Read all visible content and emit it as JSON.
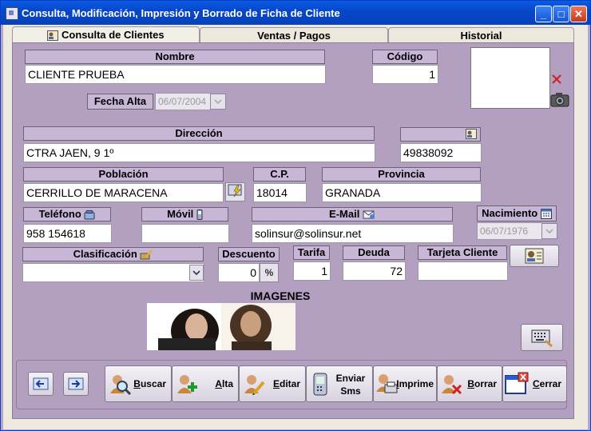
{
  "window": {
    "title": "Consulta, Modificación, Impresión y Borrado de Ficha de Cliente",
    "min_label": "_",
    "max_label": "□",
    "close_label": "✕"
  },
  "tabs": [
    {
      "label": "Consulta de Clientes",
      "active": true
    },
    {
      "label": "Ventas / Pagos",
      "active": false
    },
    {
      "label": "Historial",
      "active": false
    }
  ],
  "form": {
    "nombre": {
      "label": "Nombre",
      "value": "CLIENTE PRUEBA"
    },
    "codigo": {
      "label": "Código",
      "value": "1"
    },
    "fecha_alta": {
      "label": "Fecha Alta",
      "value": "06/07/2004"
    },
    "direccion": {
      "label": "Dirección",
      "value": "CTRA JAEN, 9 1º"
    },
    "dni": {
      "label": "",
      "value": "49838092"
    },
    "poblacion": {
      "label": "Población",
      "value": "CERRILLO DE MARACENA"
    },
    "cp": {
      "label": "C.P.",
      "value": "18014"
    },
    "provincia": {
      "label": "Provincia",
      "value": "GRANADA"
    },
    "telefono": {
      "label": "Teléfono",
      "value": "958 154618"
    },
    "movil": {
      "label": "Móvil",
      "value": ""
    },
    "email": {
      "label": "E-Mail",
      "value": "solinsur@solinsur.net"
    },
    "nacimiento": {
      "label": "Nacimiento",
      "value": "06/07/1976"
    },
    "clasificacion": {
      "label": "Clasificación",
      "value": ""
    },
    "descuento": {
      "label": "Descuento",
      "value": "0",
      "unit": "%"
    },
    "tarifa": {
      "label": "Tarifa",
      "value": "1"
    },
    "deuda": {
      "label": "Deuda",
      "value": "72"
    },
    "tarjeta_cliente": {
      "label": "Tarjeta Cliente",
      "value": ""
    }
  },
  "imagenes_label": "IMAGENES",
  "toolbar": {
    "buscar": {
      "pre": "",
      "u": "B",
      "post": "uscar"
    },
    "alta": {
      "pre": "",
      "u": "A",
      "post": "lta"
    },
    "editar": {
      "pre": "",
      "u": "E",
      "post": "ditar"
    },
    "enviar_sms": {
      "line1": "Enviar",
      "line2": "Sms"
    },
    "imprime": {
      "pre": "",
      "u": "I",
      "post": "mprime"
    },
    "borrar": {
      "pre": "",
      "u": "B",
      "post": "orrar"
    },
    "cerrar": {
      "pre": "",
      "u": "C",
      "post": "errar"
    }
  }
}
